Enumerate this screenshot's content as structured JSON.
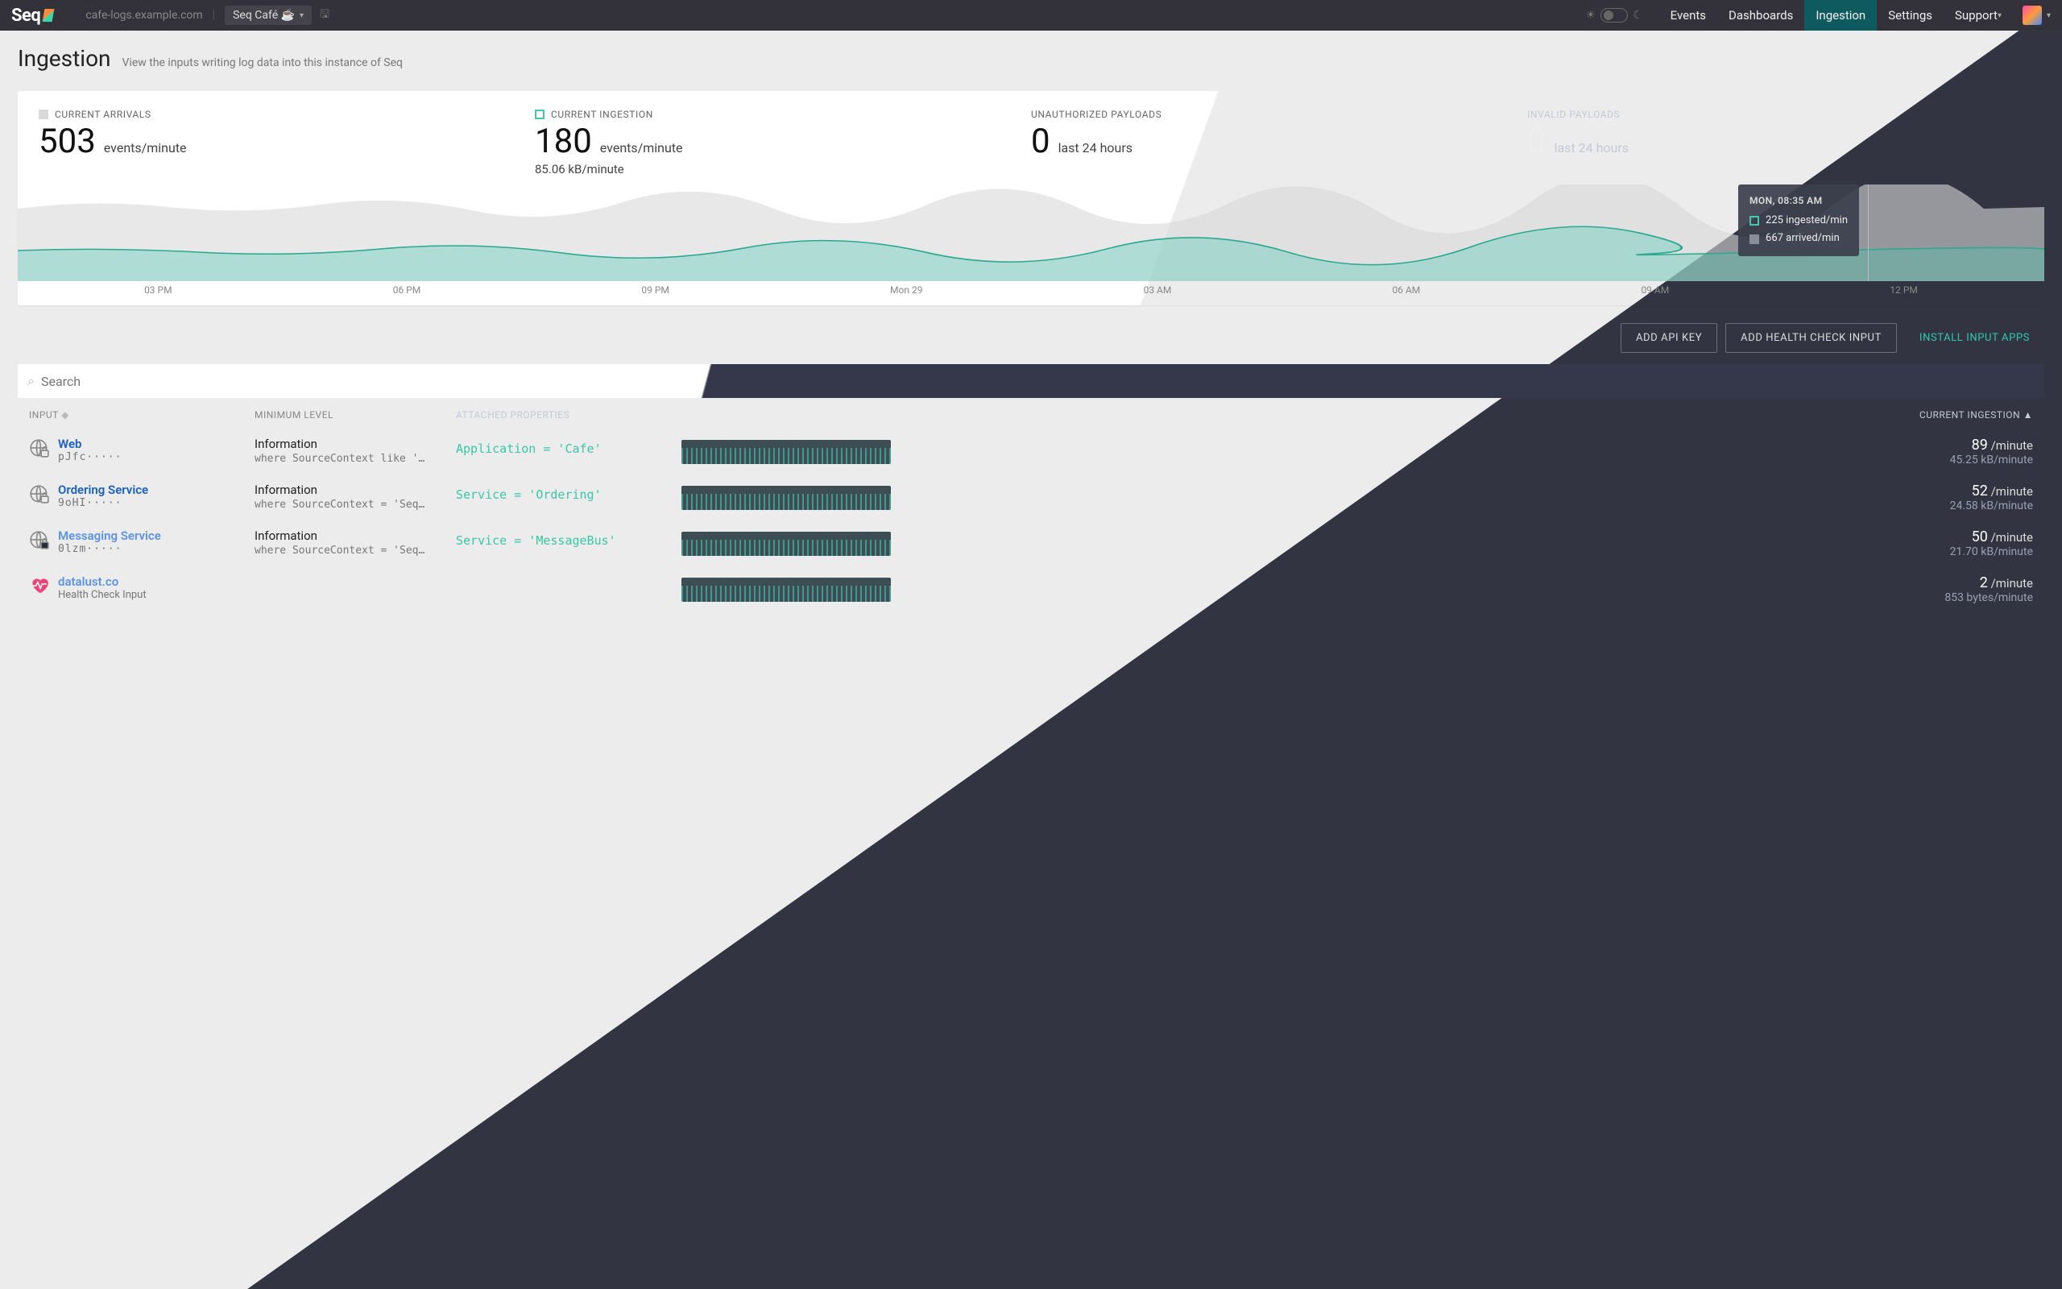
{
  "brand": "Seq",
  "host": "cafe-logs.example.com",
  "workspace": "Seq Café ☕",
  "nav": {
    "events": "Events",
    "dashboards": "Dashboards",
    "ingestion": "Ingestion",
    "settings": "Settings",
    "support": "Support"
  },
  "page": {
    "title": "Ingestion",
    "subtitle": "View the inputs writing log data into this instance of Seq"
  },
  "stats": {
    "arrivals": {
      "label": "CURRENT ARRIVALS",
      "value": "503",
      "unit": "events/minute"
    },
    "ingestion": {
      "label": "CURRENT INGESTION",
      "value": "180",
      "unit": "events/minute",
      "extra": "85.06 kB/minute"
    },
    "unauth": {
      "label": "UNAUTHORIZED PAYLOADS",
      "value": "0",
      "unit": "last 24 hours"
    },
    "invalid": {
      "label": "INVALID PAYLOADS",
      "value": "0",
      "unit": "last 24 hours"
    }
  },
  "chart_data": {
    "type": "area",
    "x_ticks": [
      "03 PM",
      "06 PM",
      "09 PM",
      "Mon 29",
      "03 AM",
      "06 AM",
      "09 AM",
      "12 PM"
    ],
    "series": [
      {
        "name": "arrived/min",
        "color": "#c9c9c9",
        "approx_range": [
          400,
          700
        ]
      },
      {
        "name": "ingested/min",
        "color": "#46c7b0",
        "approx_range": [
          150,
          250
        ]
      }
    ],
    "tooltip": {
      "time": "MON, 08:35 AM",
      "ingested": "225 ingested/min",
      "arrived": "667 arrived/min"
    }
  },
  "actions": {
    "add_key": "ADD API KEY",
    "add_health": "ADD HEALTH CHECK INPUT",
    "install": "INSTALL INPUT APPS"
  },
  "search_placeholder": "Search",
  "columns": {
    "input": "INPUT",
    "level": "MINIMUM LEVEL",
    "props": "ATTACHED PROPERTIES",
    "rate": "CURRENT INGESTION"
  },
  "rows": [
    {
      "name": "Web",
      "sub": "pJfc·····",
      "level": "Information",
      "where": "where SourceContext like '…",
      "prop": "Application = 'Cafe'",
      "rate_n": "89",
      "rate_u": "/minute",
      "rate_s": "45.25 kB/minute"
    },
    {
      "name": "Ordering Service",
      "sub": "9oHI·····",
      "level": "Information",
      "where": "where SourceContext = 'Seq…",
      "prop": "Service = 'Ordering'",
      "rate_n": "52",
      "rate_u": "/minute",
      "rate_s": "24.58 kB/minute"
    },
    {
      "name": "Messaging Service",
      "sub": "0lzm·····",
      "level": "Information",
      "where": "where SourceContext = 'Seq…",
      "prop": "Service = 'MessageBus'",
      "rate_n": "50",
      "rate_u": "/minute",
      "rate_s": "21.70 kB/minute"
    },
    {
      "name": "datalust.co",
      "sub": "Health Check Input",
      "level": "",
      "where": "",
      "prop": "",
      "rate_n": "2",
      "rate_u": "/minute",
      "rate_s": "853 bytes/minute"
    }
  ]
}
